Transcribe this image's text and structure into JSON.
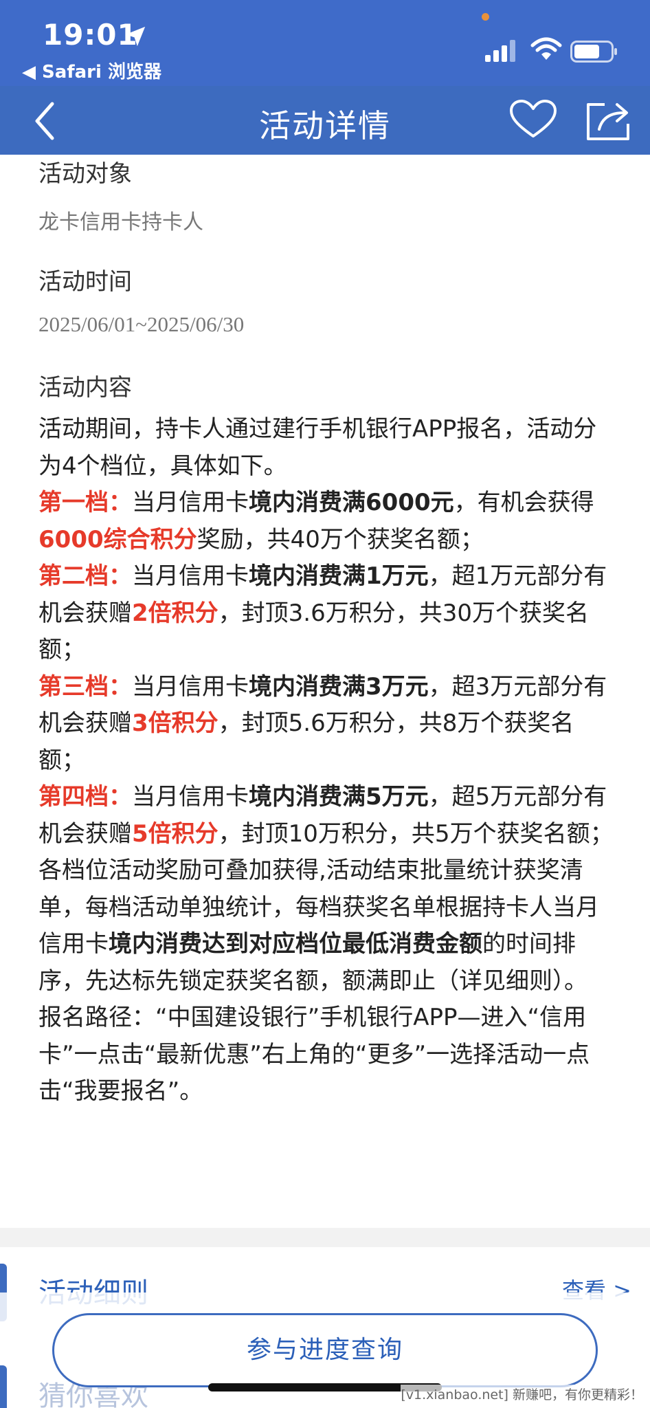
{
  "status": {
    "time": "19:01",
    "back_app": "◀ Safari 浏览器"
  },
  "nav": {
    "title": "活动详情"
  },
  "sections": {
    "target_title": "活动对象",
    "target_value": "龙卡信用卡持卡人",
    "time_title": "活动时间",
    "time_value": "2025/06/01~2025/06/30",
    "content_title": "活动内容"
  },
  "content": {
    "intro": "活动期间，持卡人通过建行手机银行APP报名，活动分为4个档位，具体如下。",
    "tier1": {
      "label": "第一档：",
      "pre": "当月信用卡",
      "cond": "境内消费满6000元",
      "mid": "，有机会获得",
      "reward": "6000综合积分",
      "post": "奖励，共40万个获奖名额；"
    },
    "tier2": {
      "label": "第二档：",
      "pre": "当月信用卡",
      "cond": "境内消费满1万元",
      "mid": "，超1万元部分有机会获赠",
      "reward": "2倍积分",
      "post": "，封顶3.6万积分，共30万个获奖名额；"
    },
    "tier3": {
      "label": "第三档：",
      "pre": "当月信用卡",
      "cond": "境内消费满3万元",
      "mid": "，超3万元部分有机会获赠",
      "reward": "3倍积分",
      "post": "，封顶5.6万积分，共8万个获奖名额；"
    },
    "tier4": {
      "label": "第四档：",
      "pre": "当月信用卡",
      "cond": "境内消费满5万元",
      "mid": "，超5万元部分有机会获赠",
      "reward": "5倍积分",
      "post": "，封顶10万积分，共5万个获奖名额；"
    },
    "stack_pre": "各档位活动奖励可叠加获得,活动结束批量统计获奖清单，每档活动单独统计，每档获奖名单根据持卡人当月信用卡",
    "stack_bold": "境内消费达到对应档位最低消费金额",
    "stack_post": "的时间排序，先达标先锁定获奖名额，额满即止（详见细则）。",
    "path": "报名路径：“中国建设银行”手机银行APP—进入“信用卡”一点击“最新优惠”右上角的“更多”一选择活动一点击“我要报名”。"
  },
  "rules": {
    "title": "活动细则",
    "view": "查看 >"
  },
  "guess": {
    "title": "猜你喜欢"
  },
  "button": {
    "progress": "参与进度查询"
  },
  "watermark": "[v1.xianbao.net] 新赚吧，有你更精彩！",
  "colors": {
    "header_blue": "#3d6bbf",
    "highlight_red": "#e63a2a"
  }
}
